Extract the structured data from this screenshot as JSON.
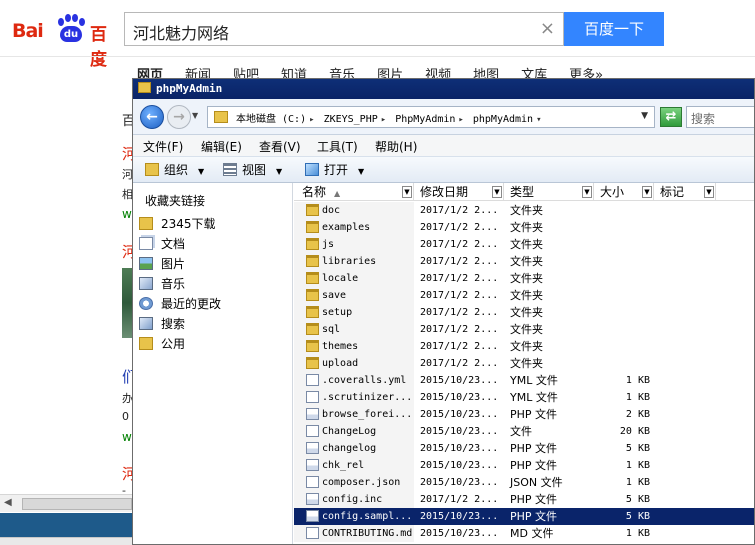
{
  "browser": {
    "logo": {
      "text_left": "Bai",
      "paw_text": "du",
      "text_right": "百度"
    },
    "search": {
      "query": "河北魅力网络",
      "button": "百度一下",
      "clear": "×"
    },
    "nav": [
      "网页",
      "新闻",
      "贴吧",
      "知道",
      "音乐",
      "图片",
      "视频",
      "地图",
      "文库",
      "更多»"
    ],
    "fragments": [
      "百",
      "河",
      "河",
      "相",
      "w",
      "河",
      "们",
      "办",
      "0",
      "w",
      "河",
      "-"
    ]
  },
  "explorer": {
    "title": "phpMyAdmin",
    "path": [
      "本地磁盘 (C:)",
      "ZKEYS_PHP",
      "PhpMyAdmin",
      "phpMyAdmin"
    ],
    "search_placeholder": "搜索",
    "menu": [
      "文件(F)",
      "编辑(E)",
      "查看(V)",
      "工具(T)",
      "帮助(H)"
    ],
    "toolbar": {
      "organize": "组织",
      "views": "视图",
      "open": "打开"
    },
    "navpane": {
      "header": "收藏夹链接",
      "items": [
        {
          "label": "2345下载",
          "icon": "folder-icon"
        },
        {
          "label": "文档",
          "icon": "documents-icon"
        },
        {
          "label": "图片",
          "icon": "pictures-icon"
        },
        {
          "label": "音乐",
          "icon": "music-icon"
        },
        {
          "label": "最近的更改",
          "icon": "recent-changes-icon"
        },
        {
          "label": "搜索",
          "icon": "search-icon"
        },
        {
          "label": "公用",
          "icon": "public-folder-icon"
        }
      ]
    },
    "columns": [
      "名称",
      "修改日期",
      "类型",
      "大小",
      "标记"
    ],
    "files": [
      {
        "name": "doc",
        "date": "2017/1/2 2...",
        "type": "文件夹",
        "size": "",
        "kind": "folder"
      },
      {
        "name": "examples",
        "date": "2017/1/2 2...",
        "type": "文件夹",
        "size": "",
        "kind": "folder"
      },
      {
        "name": "js",
        "date": "2017/1/2 2...",
        "type": "文件夹",
        "size": "",
        "kind": "folder"
      },
      {
        "name": "libraries",
        "date": "2017/1/2 2...",
        "type": "文件夹",
        "size": "",
        "kind": "folder"
      },
      {
        "name": "locale",
        "date": "2017/1/2 2...",
        "type": "文件夹",
        "size": "",
        "kind": "folder"
      },
      {
        "name": "save",
        "date": "2017/1/2 2...",
        "type": "文件夹",
        "size": "",
        "kind": "folder"
      },
      {
        "name": "setup",
        "date": "2017/1/2 2...",
        "type": "文件夹",
        "size": "",
        "kind": "folder"
      },
      {
        "name": "sql",
        "date": "2017/1/2 2...",
        "type": "文件夹",
        "size": "",
        "kind": "folder"
      },
      {
        "name": "themes",
        "date": "2017/1/2 2...",
        "type": "文件夹",
        "size": "",
        "kind": "folder"
      },
      {
        "name": "upload",
        "date": "2017/1/2 2...",
        "type": "文件夹",
        "size": "",
        "kind": "folder"
      },
      {
        "name": ".coveralls.yml",
        "date": "2015/10/23...",
        "type": "YML 文件",
        "size": "1 KB",
        "kind": "file"
      },
      {
        "name": ".scrutinizer...",
        "date": "2015/10/23...",
        "type": "YML 文件",
        "size": "1 KB",
        "kind": "file"
      },
      {
        "name": "browse_forei...",
        "date": "2015/10/23...",
        "type": "PHP 文件",
        "size": "2 KB",
        "kind": "php"
      },
      {
        "name": "ChangeLog",
        "date": "2015/10/23...",
        "type": "文件",
        "size": "20 KB",
        "kind": "file"
      },
      {
        "name": "changelog",
        "date": "2015/10/23...",
        "type": "PHP 文件",
        "size": "5 KB",
        "kind": "php"
      },
      {
        "name": "chk_rel",
        "date": "2015/10/23...",
        "type": "PHP 文件",
        "size": "1 KB",
        "kind": "php"
      },
      {
        "name": "composer.json",
        "date": "2015/10/23...",
        "type": "JSON 文件",
        "size": "1 KB",
        "kind": "file"
      },
      {
        "name": "config.inc",
        "date": "2017/1/2 2...",
        "type": "PHP 文件",
        "size": "5 KB",
        "kind": "php"
      },
      {
        "name": "config.sampl...",
        "date": "2015/10/23...",
        "type": "PHP 文件",
        "size": "5 KB",
        "kind": "php",
        "selected": true
      },
      {
        "name": "CONTRIBUTING.md",
        "date": "2015/10/23...",
        "type": "MD 文件",
        "size": "1 KB",
        "kind": "file"
      }
    ]
  }
}
